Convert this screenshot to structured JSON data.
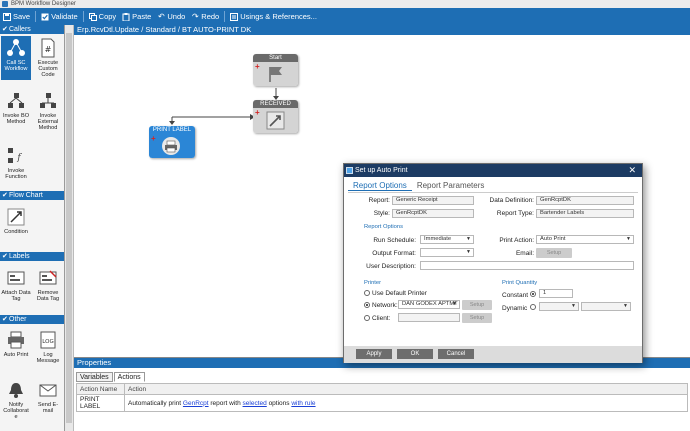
{
  "window": {
    "title": "BPM Workflow Designer"
  },
  "toolbar": {
    "save": "Save",
    "validate": "Validate",
    "copy": "Copy",
    "paste": "Paste",
    "undo": "Undo",
    "redo": "Redo",
    "usings": "Usings & References..."
  },
  "palette": {
    "callers_header": "Callers",
    "call_sc_workflow": "Call SC Workflow",
    "execute_custom_code": "Execute Custom Code",
    "invoke_bo_method": "Invoke BO Method",
    "invoke_external_method": "Invoke External Method",
    "invoke_function": "Invoke Function",
    "flowchart_header": "Flow Chart",
    "condition": "Condition",
    "labels_header": "Labels",
    "attach_data_tag": "Attach Data Tag",
    "remove_data_tag": "Remove Data Tag",
    "other_header": "Other",
    "auto_print": "Auto Print",
    "log_message": "Log Message",
    "notify_collaborate": "Notify Collaborat e",
    "send_email": "Send E-mail"
  },
  "canvas": {
    "breadcrumb": "Erp.RcvDtl.Update / Standard / BT AUTO-PRINT DK",
    "nodes": {
      "start": "Start",
      "received": "RECEIVED",
      "print_label": "PRINT LABEL"
    }
  },
  "properties": {
    "title": "Properties",
    "tab_variables": "Variables",
    "tab_actions": "Actions",
    "col_action_name": "Action Name",
    "col_action": "Action",
    "row_name": "PRINT LABEL",
    "row_text1": "Automatically print ",
    "row_link1": "GenRcpt",
    "row_text2": " report with ",
    "row_link2": "selected",
    "row_text3": " options ",
    "row_link3": "with rule"
  },
  "dialog": {
    "title": "Set up Auto Print",
    "tab_report_options": "Report Options",
    "tab_report_parameters": "Report Parameters",
    "report_label": "Report:",
    "report_value": "Generic Receipt",
    "style_label": "Style:",
    "style_value": "GenRcptDK",
    "data_definition_label": "Data Definition:",
    "data_definition_value": "GenRcptDK",
    "report_type_label": "Report Type:",
    "report_type_value": "Bartender Labels",
    "group_report_options": "Report Options",
    "run_schedule_label": "Run Schedule:",
    "run_schedule_value": "Immediate",
    "output_format_label": "Output Format:",
    "print_action_label": "Print Action:",
    "print_action_value": "Auto Print",
    "email_label": "Email:",
    "email_setup_btn": "Setup",
    "user_description_label": "User Description:",
    "group_printer": "Printer",
    "use_default_printer": "Use Default Printer",
    "network_label": "Network:",
    "network_value": "DAN GODEX APTMT",
    "client_label": "Client:",
    "setup_btn": "Setup",
    "group_print_quantity": "Print Quantity",
    "constant_label": "Constant",
    "constant_value": "1",
    "dynamic_label": "Dynamic",
    "apply_btn": "Apply",
    "ok_btn": "OK",
    "cancel_btn": "Cancel"
  },
  "colors": {
    "accent": "#1e6eb4",
    "dialog_title": "#1c3b63",
    "node_blue": "#2b86d6",
    "node_grey": "#d4d4d4"
  }
}
